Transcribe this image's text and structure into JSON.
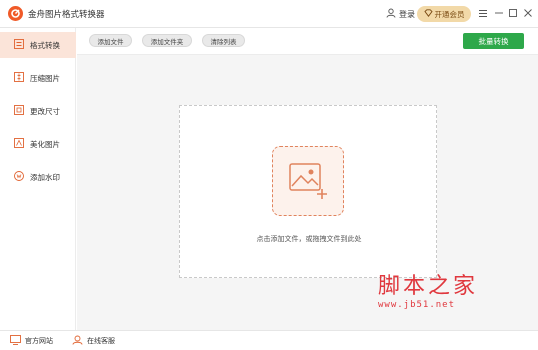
{
  "app": {
    "title": "金舟图片格式转换器"
  },
  "header": {
    "login_label": "登录",
    "vip_label": "开通会员"
  },
  "sidebar": {
    "items": [
      {
        "label": "格式转换",
        "icon": "format-convert-icon",
        "active": true
      },
      {
        "label": "压缩图片",
        "icon": "compress-icon",
        "active": false
      },
      {
        "label": "更改尺寸",
        "icon": "resize-icon",
        "active": false
      },
      {
        "label": "美化图片",
        "icon": "beautify-icon",
        "active": false
      },
      {
        "label": "添加水印",
        "icon": "watermark-icon",
        "active": false
      }
    ]
  },
  "toolbar": {
    "add_file": "添加文件",
    "add_folder": "添加文件夹",
    "clear_list": "清除列表",
    "batch_convert": "批量转换"
  },
  "dropzone": {
    "hint": "点击添加文件，或拖拽文件到此处"
  },
  "footer": {
    "website": "官方网站",
    "service": "在线客服"
  },
  "watermark": {
    "text": "脚本之家",
    "url": "www.jb51.net"
  },
  "colors": {
    "brand": "#f05a28",
    "accent": "#2ea84a",
    "active_bg": "#fbe4d9",
    "vip_bg": "#f2d9a8",
    "watermark": "#e0383e"
  }
}
